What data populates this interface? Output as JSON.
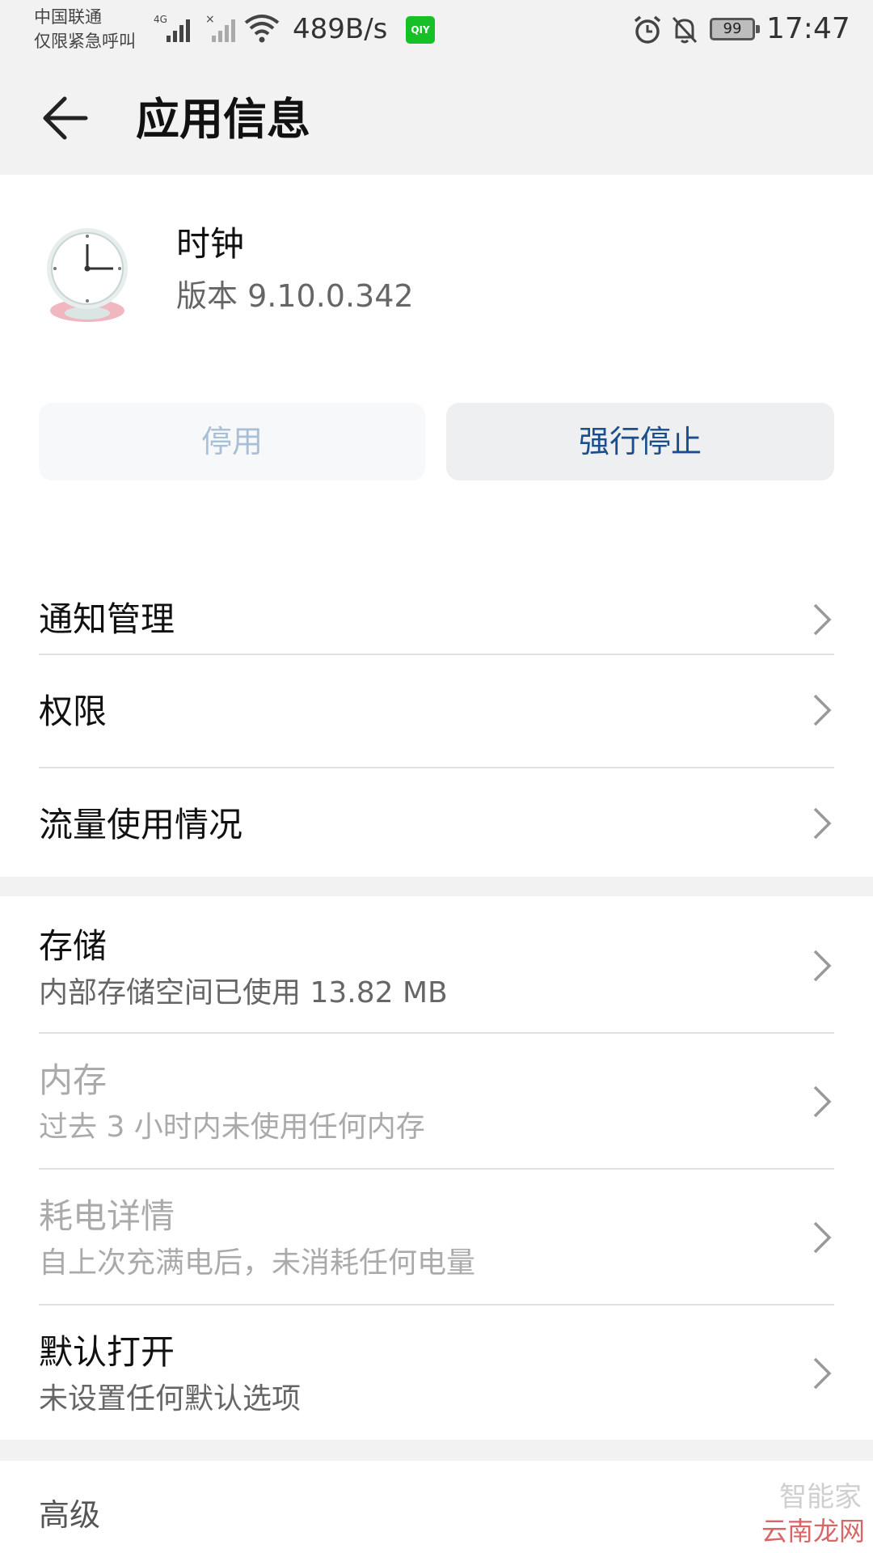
{
  "status_bar": {
    "carrier_line1": "中国联通",
    "carrier_line2": "仅限紧急呼叫",
    "network_type": "4G",
    "net_speed": "489B/s",
    "app_badge": "QIY",
    "battery_level": "99",
    "time": "17:47"
  },
  "app_bar": {
    "title": "应用信息"
  },
  "app": {
    "name": "时钟",
    "version": "版本 9.10.0.342"
  },
  "buttons": {
    "disable_label": "停用",
    "force_stop_label": "强行停止"
  },
  "menu_top": [
    {
      "title": "通知管理"
    },
    {
      "title": "权限"
    },
    {
      "title": "流量使用情况"
    }
  ],
  "menu_mid": [
    {
      "title": "存储",
      "subtitle": "内部存储空间已使用 13.82 MB"
    },
    {
      "title": "内存",
      "subtitle": "过去 3 小时内未使用任何内存"
    },
    {
      "title": "耗电详情",
      "subtitle": "自上次充满电后，未消耗任何电量"
    },
    {
      "title": "默认打开",
      "subtitle": "未设置任何默认选项"
    }
  ],
  "advanced": {
    "title": "高级"
  },
  "watermark": {
    "line1": "智能家",
    "line2": "云南龙网"
  },
  "colors": {
    "background": "#f2f2f2",
    "card": "#ffffff",
    "accent_text": "#1a4f8b",
    "disabled_text": "#a8bfd6",
    "iqiyi_green": "#18c027"
  }
}
